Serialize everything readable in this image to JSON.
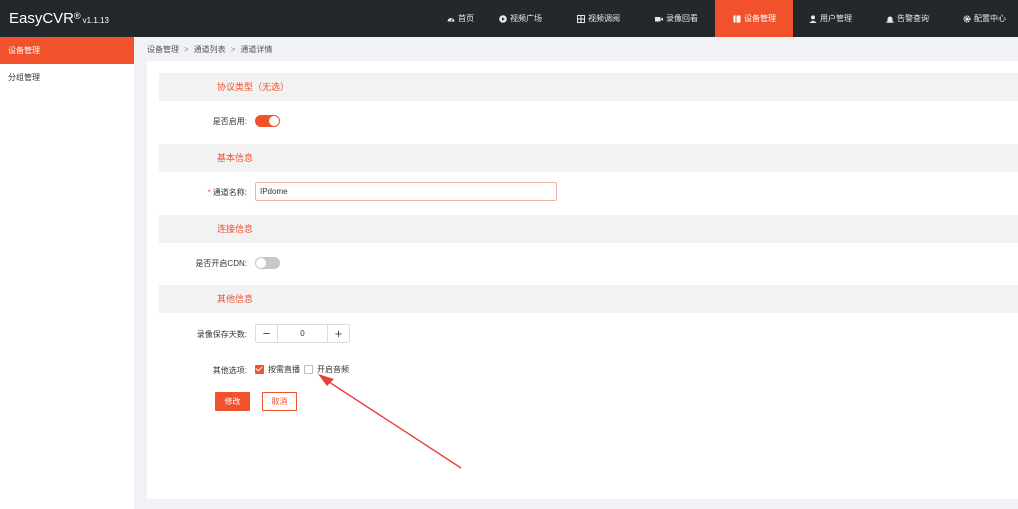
{
  "header": {
    "brand": "EasyCVR",
    "brand_mark": "®",
    "version": "v1.1.13",
    "nav": [
      {
        "label": "首页",
        "icon": "dashboard-icon"
      },
      {
        "label": "视频广场",
        "icon": "play-icon"
      },
      {
        "label": "视频调阅",
        "icon": "grid-icon"
      },
      {
        "label": "录像回看",
        "icon": "video-camera-icon"
      },
      {
        "label": "设备管理",
        "icon": "device-icon",
        "active": true
      },
      {
        "label": "用户管理",
        "icon": "user-icon"
      },
      {
        "label": "告警查询",
        "icon": "alarm-icon"
      },
      {
        "label": "配置中心",
        "icon": "gear-icon"
      }
    ]
  },
  "sidebar": {
    "items": [
      {
        "label": "设备管理",
        "active": true
      },
      {
        "label": "分组管理",
        "active": false
      }
    ]
  },
  "breadcrumb": [
    "设备管理",
    "通道列表",
    "通道详情"
  ],
  "breadcrumb_sep": ">",
  "sections": {
    "protocol": "协议类型（无选）",
    "basic": "基本信息",
    "connection": "连接信息",
    "other": "其他信息"
  },
  "form": {
    "enabled": {
      "label": "是否启用:",
      "value": true
    },
    "channel_name": {
      "label": "通道名称:",
      "required_mark": "*",
      "value": "IPdome"
    },
    "cdn": {
      "label": "是否开启CDN:",
      "value": false
    },
    "record_days": {
      "label": "录像保存天数:",
      "value": "0"
    },
    "options": {
      "label": "其他选项:",
      "items": [
        {
          "label": "按需直播",
          "checked": true
        },
        {
          "label": "开启音频",
          "checked": false
        }
      ]
    }
  },
  "actions": {
    "submit": "修改",
    "cancel": "取消"
  },
  "colors": {
    "accent": "#f1512b",
    "header_bg": "#23282d",
    "page_bg": "#f0f2f5",
    "annotation": "#e8403a"
  }
}
